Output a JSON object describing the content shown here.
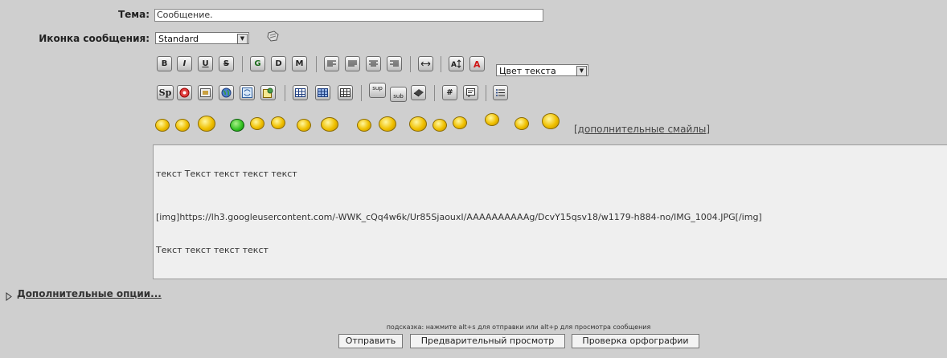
{
  "subject": {
    "label": "Тема:",
    "value": "Сообщение."
  },
  "message_icon": {
    "label": "Иконка сообщения:",
    "selected": "Standard"
  },
  "toolbar": {
    "bold": "B",
    "italic": "I",
    "underline": "U",
    "strike": "S",
    "g": "G",
    "d": "D",
    "m": "M",
    "text_color_select": "Цвет текста",
    "sp": "Sp",
    "sup": "sup",
    "sub": "sub",
    "hash": "#"
  },
  "smilies": {
    "more_link": "[дополнительные смайлы]"
  },
  "editor": {
    "line1": "текст Текст текст текст текст",
    "line2": "[img]https://lh3.googleusercontent.com/-WWK_cQq4w6k/Ur85SjaouxI/AAAAAAAAAAg/DcvY15qsv18/w1179-h884-no/IMG_1004.JPG[/img]",
    "line3": "Текст текст текст текст"
  },
  "additional_options": "Дополнительные опции...",
  "hint": "подсказка: нажмите alt+s для отправки или alt+p для просмотра сообщения",
  "buttons": {
    "submit": "Отправить",
    "preview": "Предварительный просмотр",
    "spellcheck": "Проверка орфографии"
  }
}
